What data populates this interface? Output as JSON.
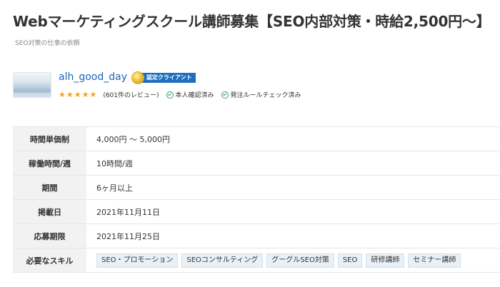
{
  "job": {
    "title": "Webマーケティングスクール講師募集【SEO内部対策・時給2,500円〜】",
    "category": "SEO対策の仕事の依頼"
  },
  "client": {
    "name": "alh_good_day",
    "badge_label": "認定クライアント",
    "stars": "★★★★★",
    "rating": 5,
    "reviews_text": "(601件のレビュー)",
    "identity_verified": "本人確認済み",
    "ordering_rules_checked": "発注ルールチェック済み"
  },
  "details": {
    "hourly_rate": {
      "label": "時間単価制",
      "value": "4,000円 〜 5,000円"
    },
    "working_hours": {
      "label": "稼働時間/週",
      "value": "10時間/週"
    },
    "duration": {
      "label": "期間",
      "value": "6ヶ月以上"
    },
    "posted_date": {
      "label": "掲載日",
      "value": "2021年11月11日"
    },
    "deadline": {
      "label": "応募期限",
      "value": "2021年11月25日"
    },
    "skills": {
      "label": "必要なスキル",
      "items": [
        "SEO・プロモーション",
        "SEOコンサルティング",
        "グーグルSEO対策",
        "SEO",
        "研修講師",
        "セミナー講師"
      ]
    }
  },
  "colors": {
    "link": "#1a66b8",
    "badge_bg": "#1f6fc0",
    "star": "#f4a019",
    "check": "#3aa35c",
    "header_cell_bg": "#f2f2f2",
    "tag_bg": "#e9f1f7"
  },
  "icons": {
    "badge": "medal-icon",
    "verified": "check-circle-icon",
    "rules_checked": "check-circle-icon"
  }
}
